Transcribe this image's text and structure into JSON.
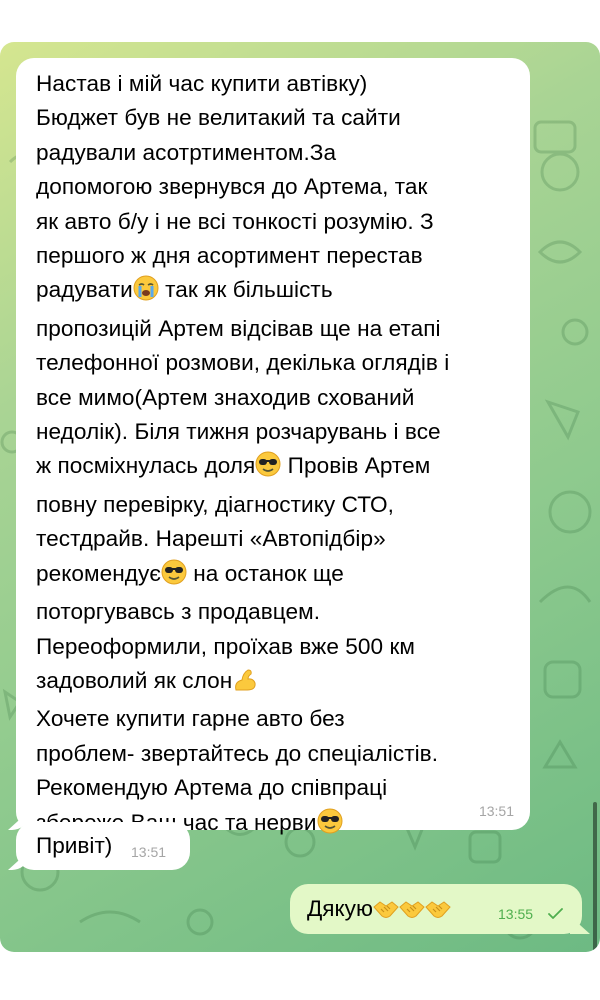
{
  "messages": {
    "incoming_long": {
      "lines": [
        "Настав і мій час купити автівку)",
        "Бюджет був не велитакий та сайти",
        "радували асотртиментом.За",
        "допомогою звернувся до Артема, так",
        "як авто б/у і не всі тонкості розумію. З",
        "першого ж дня асортимент перестав",
        "радувати",
        "так як більшість",
        "пропозицій Артем відсівав ще на етапі",
        "телефонної розмови, декілька оглядів і",
        "все мимо(Артем знаходив схований",
        "недолік). Біля тижня розчарувань і все",
        "ж посміхнулась доля",
        "Провів Артем",
        "повну перевірку, діагностику СТО,",
        "тестдрайв. Нарешті «Автопідбір»",
        "рекомендує",
        "на останок ще",
        "поторгувавсь з продавцем.",
        "Переоформили, проїхав вже 500 км",
        "задоволий як слон",
        "Хочете купити гарне авто без",
        "проблем- звертайтесь до спеціалістів.",
        "Рекомендую Артема до співпраці",
        "збереже Ваш час та нерви"
      ],
      "time": "13:51"
    },
    "incoming_short": {
      "text": "Привіт)",
      "time": "13:51"
    },
    "outgoing": {
      "text": "Дякую",
      "time": "13:55",
      "status_icon": "double-check-icon"
    }
  },
  "icons": {
    "crying": "crying-face-icon",
    "sunglasses": "sunglasses-face-icon",
    "flexed": "flexed-biceps-icon",
    "handshake": "handshake-icon"
  },
  "colors": {
    "incoming_bubble": "#ffffff",
    "outgoing_bubble": "#e3f8c7",
    "outgoing_time": "#4fae4e",
    "time_gray": "#a5a5a5",
    "wallpaper_start": "#d5e690",
    "wallpaper_end": "#6dba83"
  }
}
